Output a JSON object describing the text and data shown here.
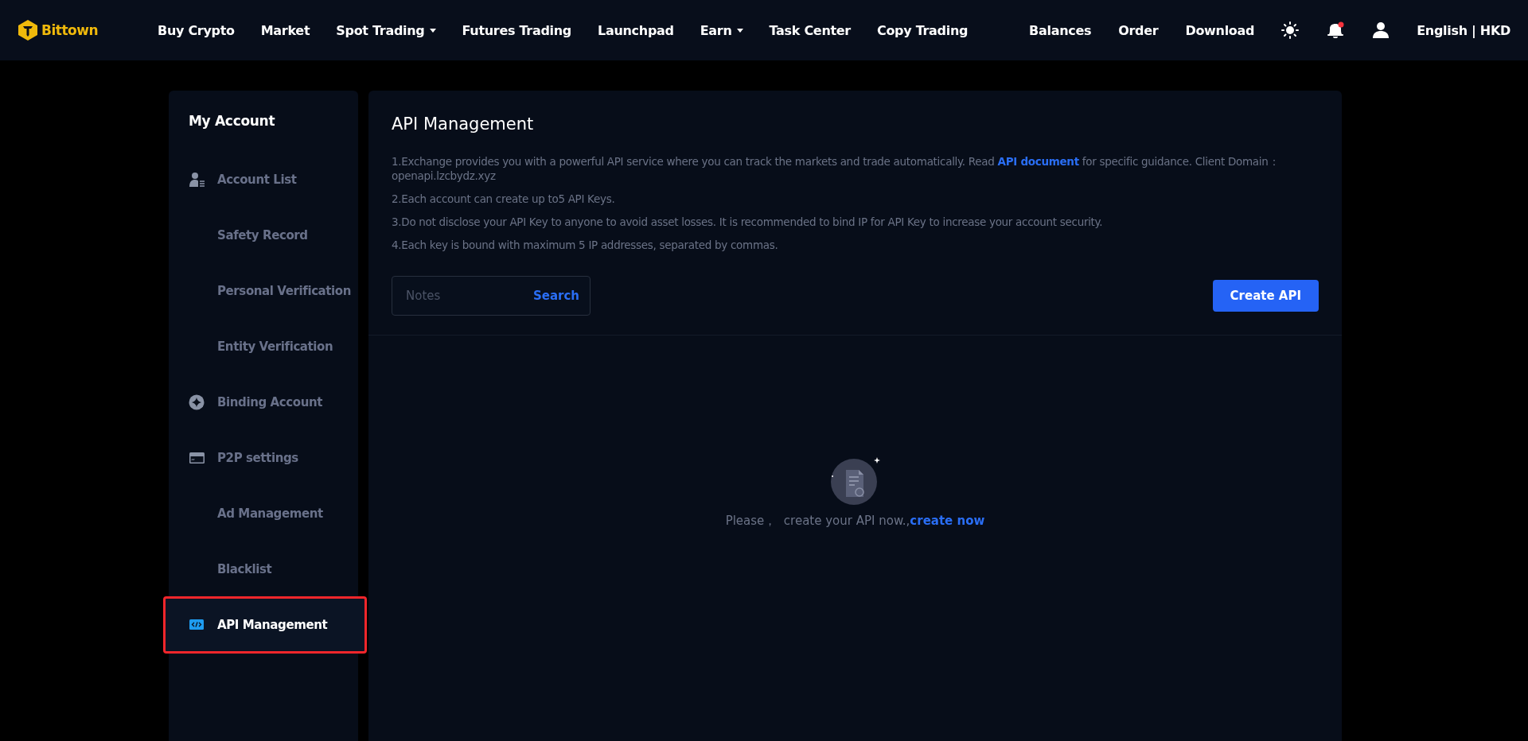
{
  "header": {
    "logo": "Bittown",
    "nav": [
      {
        "label": "Buy Crypto",
        "dropdown": false
      },
      {
        "label": "Market",
        "dropdown": false
      },
      {
        "label": "Spot Trading",
        "dropdown": true
      },
      {
        "label": "Futures Trading",
        "dropdown": false
      },
      {
        "label": "Launchpad",
        "dropdown": false
      },
      {
        "label": "Earn",
        "dropdown": true
      },
      {
        "label": "Task Center",
        "dropdown": false
      },
      {
        "label": "Copy Trading",
        "dropdown": false
      }
    ],
    "right_links": [
      "Balances",
      "Order",
      "Download"
    ],
    "notification_dot": true,
    "language": "English | HKD"
  },
  "sidebar": {
    "title": "My Account",
    "items": [
      {
        "label": "Account List",
        "kind": "group",
        "selected": false,
        "highlighted": false
      },
      {
        "label": "Safety Record",
        "kind": "sub",
        "selected": false,
        "highlighted": false
      },
      {
        "label": "Personal Verification",
        "kind": "sub",
        "selected": false,
        "highlighted": false
      },
      {
        "label": "Entity Verification",
        "kind": "sub",
        "selected": false,
        "highlighted": false
      },
      {
        "label": "Binding Account",
        "kind": "group",
        "selected": false,
        "highlighted": false
      },
      {
        "label": "P2P settings",
        "kind": "group",
        "selected": false,
        "highlighted": false
      },
      {
        "label": "Ad Management",
        "kind": "sub",
        "selected": false,
        "highlighted": false
      },
      {
        "label": "Blacklist",
        "kind": "sub",
        "selected": false,
        "highlighted": false
      },
      {
        "label": "API Management",
        "kind": "group",
        "selected": true,
        "highlighted": true
      }
    ]
  },
  "main": {
    "title": "API Management",
    "notes": [
      "1.Exchange provides you with a powerful API service where you can track the markets and trade automatically. Read **API document** for specific guidance. Client Domain：openapi.lzcbydz.xyz",
      "2.Each account can create up to5 API Keys.",
      "3.Do not disclose your API Key to anyone to avoid asset losses. It is recommended to bind IP for API Key to increase your account security.",
      "4.Each key is bound with maximum 5 IP addresses, separated by commas."
    ],
    "search": {
      "placeholder": "Notes",
      "button": "Search"
    },
    "create_button": "Create API",
    "empty": {
      "text": "Please，  create your API now.,",
      "link": "create now"
    }
  }
}
